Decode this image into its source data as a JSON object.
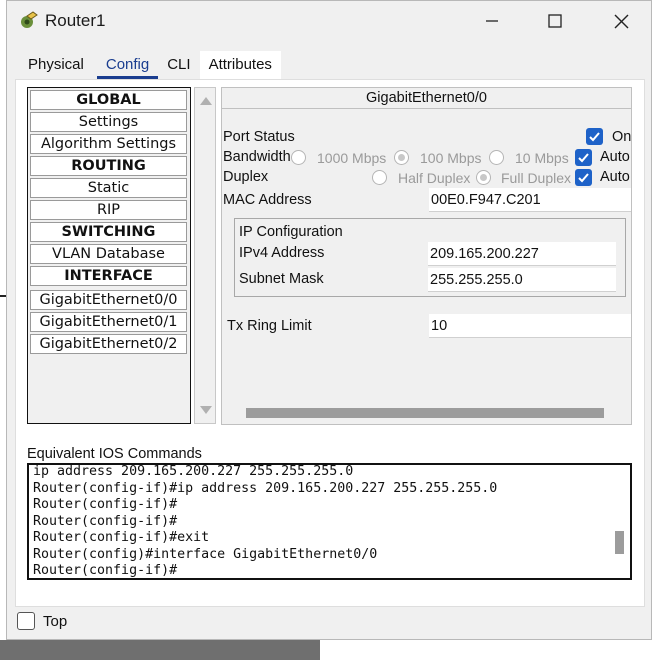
{
  "window": {
    "title": "Router1"
  },
  "tabs": [
    {
      "label": "Physical"
    },
    {
      "label": "Config"
    },
    {
      "label": "CLI"
    },
    {
      "label": "Attributes"
    }
  ],
  "nav": {
    "items": [
      {
        "label": "GLOBAL",
        "type": "header"
      },
      {
        "label": "Settings",
        "type": "item"
      },
      {
        "label": "Algorithm Settings",
        "type": "item"
      },
      {
        "label": "ROUTING",
        "type": "header"
      },
      {
        "label": "Static",
        "type": "item"
      },
      {
        "label": "RIP",
        "type": "item"
      },
      {
        "label": "SWITCHING",
        "type": "header"
      },
      {
        "label": "VLAN Database",
        "type": "item"
      },
      {
        "label": "INTERFACE",
        "type": "header"
      },
      {
        "label": "GigabitEthernet0/0",
        "type": "item"
      },
      {
        "label": "GigabitEthernet0/1",
        "type": "item"
      },
      {
        "label": "GigabitEthernet0/2",
        "type": "item"
      }
    ]
  },
  "interface": {
    "title": "GigabitEthernet0/0",
    "port_status_label": "Port Status",
    "on_label": "On",
    "bandwidth_label": "Bandwidth",
    "bw_1000": "1000 Mbps",
    "bw_100": "100 Mbps",
    "bw_10": "10 Mbps",
    "auto_label": "Auto",
    "duplex_label": "Duplex",
    "half_duplex": "Half Duplex",
    "full_duplex": "Full Duplex",
    "mac_label": "MAC Address",
    "mac_value": "00E0.F947.C201",
    "ip_config_label": "IP Configuration",
    "ipv4_label": "IPv4 Address",
    "ipv4_value": "209.165.200.227",
    "mask_label": "Subnet Mask",
    "mask_value": "255.255.255.0",
    "tx_label": "Tx Ring Limit",
    "tx_value": "10"
  },
  "ios": {
    "label": "Equivalent IOS Commands",
    "lines": [
      "ip address 209.165.200.227 255.255.255.0",
      "Router(config-if)#ip address 209.165.200.227 255.255.255.0",
      "Router(config-if)#",
      "Router(config-if)#",
      "Router(config-if)#exit",
      "Router(config)#interface GigabitEthernet0/0",
      "Router(config-if)#"
    ]
  },
  "footer": {
    "top_label": "Top"
  },
  "colors": {
    "accent": "#1e62c8",
    "tab_active": "#1a3d8f"
  }
}
